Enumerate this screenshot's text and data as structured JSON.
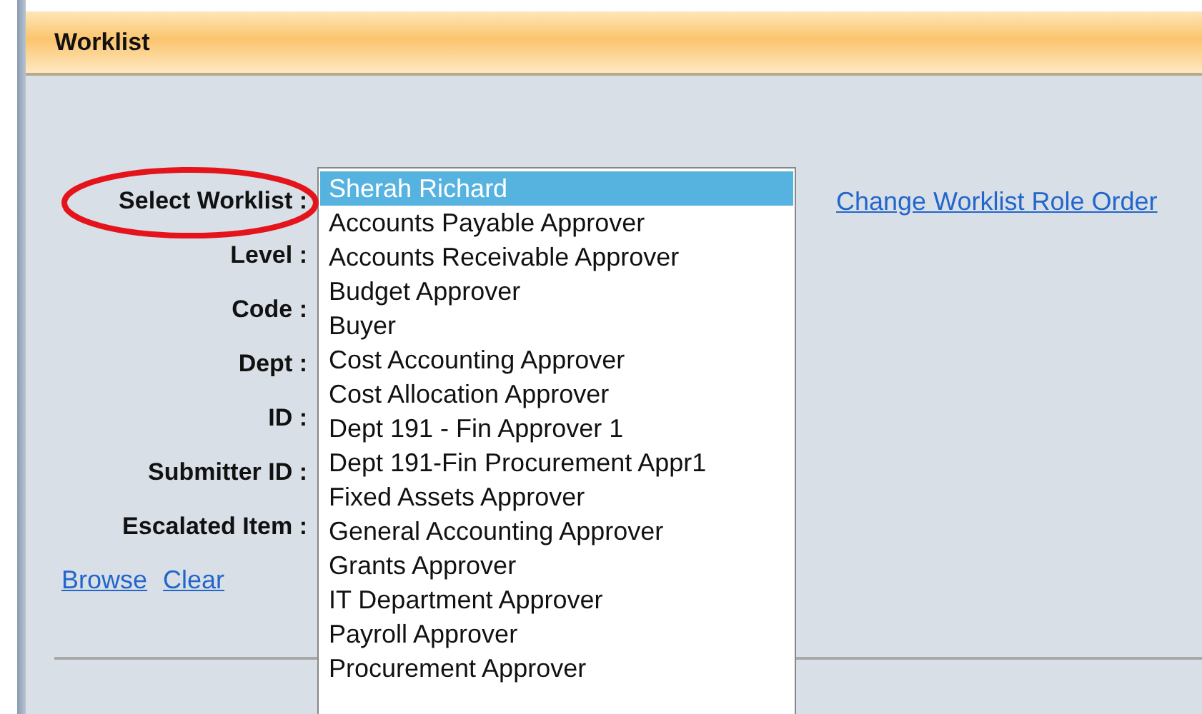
{
  "header": {
    "title": "Worklist"
  },
  "fields": [
    {
      "label": "Select Worklist :",
      "kind": "select"
    },
    {
      "label": "Level :",
      "kind": "text"
    },
    {
      "label": "Code :",
      "kind": "text"
    },
    {
      "label": "Dept :",
      "kind": "text"
    },
    {
      "label": "ID :",
      "kind": "text"
    },
    {
      "label": "Submitter ID :",
      "kind": "text"
    },
    {
      "label": "Escalated Item :",
      "kind": "text"
    }
  ],
  "worklist_options": [
    {
      "label": "Sherah Richard",
      "selected": true
    },
    {
      "label": "Accounts Payable Approver",
      "selected": false
    },
    {
      "label": "Accounts Receivable Approver",
      "selected": false
    },
    {
      "label": "Budget Approver",
      "selected": false
    },
    {
      "label": "Buyer",
      "selected": false
    },
    {
      "label": "Cost Accounting Approver",
      "selected": false
    },
    {
      "label": "Cost Allocation Approver",
      "selected": false
    },
    {
      "label": "Dept 191 - Fin Approver 1",
      "selected": false
    },
    {
      "label": "Dept 191-Fin Procurement Appr1",
      "selected": false
    },
    {
      "label": "Fixed Assets Approver",
      "selected": false
    },
    {
      "label": "General Accounting Approver",
      "selected": false
    },
    {
      "label": "Grants Approver",
      "selected": false
    },
    {
      "label": "IT Department Approver",
      "selected": false
    },
    {
      "label": "Payroll Approver",
      "selected": false
    },
    {
      "label": "Procurement Approver",
      "selected": false
    }
  ],
  "role_order_link": "Change Worklist Role Order",
  "actions": [
    "Browse",
    "Clear"
  ]
}
